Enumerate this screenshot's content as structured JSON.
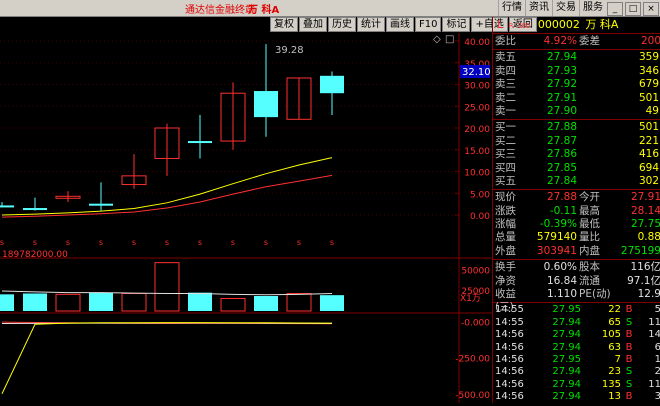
{
  "window": {
    "title": "通达信金融终端",
    "stock_title": "万 科A",
    "menu": [
      "行情",
      "资讯",
      "交易",
      "服务"
    ],
    "win_buttons": [
      "_",
      "□",
      "×"
    ]
  },
  "toolbar": [
    "复权",
    "叠加",
    "历史",
    "统计",
    "画线",
    "F10",
    "标记",
    "+自选",
    "返回"
  ],
  "chart_labels": {
    "high_mark": "39.28",
    "current_price_tag": "32.10",
    "volume_label": "189782000.00",
    "volume_unit": "X1万",
    "icons": [
      "◇",
      "□"
    ]
  },
  "chart_data": [
    {
      "type": "candlestick",
      "title": "",
      "ylim": [
        0,
        40
      ],
      "y_ticks": [
        0.0,
        5.0,
        10.0,
        15.0,
        20.0,
        25.0,
        30.0,
        35.0,
        40.0
      ],
      "candles": [
        {
          "open": 2.2,
          "close": 2.2,
          "high": 3.0,
          "low": 1.8,
          "color": "cyan"
        },
        {
          "open": 1.6,
          "close": 1.6,
          "high": 4.0,
          "low": 1.0,
          "color": "cyan"
        },
        {
          "open": 4.0,
          "close": 4.3,
          "high": 5.5,
          "low": 3.0,
          "color": "red"
        },
        {
          "open": 2.4,
          "close": 2.6,
          "high": 7.5,
          "low": 1.0,
          "color": "cyan"
        },
        {
          "open": 7.0,
          "close": 9.0,
          "high": 14.0,
          "low": 6.0,
          "color": "red"
        },
        {
          "open": 13.0,
          "close": 20.0,
          "high": 21.0,
          "low": 9.0,
          "color": "red"
        },
        {
          "open": 17.0,
          "close": 17.0,
          "high": 23.0,
          "low": 13.0,
          "color": "cyan"
        },
        {
          "open": 17.0,
          "close": 28.0,
          "high": 30.5,
          "low": 15.0,
          "color": "red"
        },
        {
          "open": 28.5,
          "close": 22.5,
          "high": 39.28,
          "low": 18.0,
          "color": "cyan"
        },
        {
          "open": 22.0,
          "close": 31.5,
          "high": 31.5,
          "low": 22.0,
          "color": "red"
        },
        {
          "open": 32.0,
          "close": 28.0,
          "high": 33.0,
          "low": 23.0,
          "color": "cyan"
        }
      ],
      "ma_series": [
        {
          "color": "#ffff00",
          "values": [
            0.0,
            0.2,
            0.5,
            0.9,
            1.5,
            2.8,
            4.8,
            7.2,
            9.5,
            11.5,
            13.2
          ]
        },
        {
          "color": "#ff3030",
          "values": [
            -0.5,
            -0.3,
            0.0,
            0.3,
            0.7,
            1.6,
            3.0,
            4.8,
            6.5,
            7.8,
            9.1
          ]
        }
      ]
    },
    {
      "type": "bar",
      "title": "",
      "ylim": [
        0,
        60000
      ],
      "y_ticks": [
        0,
        25000,
        50000
      ],
      "values": [
        20000,
        21000,
        20000,
        22000,
        21000,
        58000,
        22000,
        15000,
        18000,
        21000,
        19000
      ],
      "colors": [
        "cyan",
        "cyan",
        "red",
        "cyan",
        "red",
        "red",
        "cyan",
        "red",
        "cyan",
        "red",
        "cyan"
      ],
      "ma_values": [
        24000,
        23000,
        22000,
        22000,
        21500,
        21000,
        21000,
        20000,
        19500,
        20000,
        21000
      ]
    },
    {
      "type": "line",
      "title": "",
      "ylim": [
        -550,
        30
      ],
      "y_ticks": [
        -0.0,
        -250.0,
        -500.0
      ],
      "series": [
        {
          "color": "#ff3030",
          "values": [
            -5,
            -8,
            -10,
            -12,
            -14,
            -15,
            -14,
            -14,
            -15,
            -16,
            -17
          ]
        },
        {
          "color": "#e0e0e0",
          "values": [
            -15,
            -14,
            -13,
            -12,
            -12,
            -11,
            -11,
            -12,
            -13,
            -14,
            -15
          ]
        },
        {
          "color": "#ffff00",
          "values": [
            -500,
            -20,
            -12,
            -10,
            -10,
            -9,
            -9,
            -10,
            -10,
            -11,
            -12
          ]
        }
      ]
    }
  ],
  "quote": {
    "label": "L",
    "sub_r": "R",
    "sub_num": "300",
    "code": "000002",
    "name": "万 科A",
    "weibi_label": "委比",
    "weibi": "4.92%",
    "weicha_label": "委差",
    "weicha": "200",
    "sells": [
      {
        "label": "卖五",
        "price": "27.94",
        "vol": "359"
      },
      {
        "label": "卖四",
        "price": "27.93",
        "vol": "346"
      },
      {
        "label": "卖三",
        "price": "27.92",
        "vol": "679"
      },
      {
        "label": "卖二",
        "price": "27.91",
        "vol": "501"
      },
      {
        "label": "卖一",
        "price": "27.90",
        "vol": "49"
      }
    ],
    "buys": [
      {
        "label": "买一",
        "price": "27.88",
        "vol": "501"
      },
      {
        "label": "买二",
        "price": "27.87",
        "vol": "221"
      },
      {
        "label": "买三",
        "price": "27.86",
        "vol": "416"
      },
      {
        "label": "买四",
        "price": "27.85",
        "vol": "694"
      },
      {
        "label": "买五",
        "price": "27.84",
        "vol": "302"
      }
    ],
    "stats": [
      {
        "l1": "现价",
        "v1": "27.88",
        "c1": "red",
        "l2": "今开",
        "v2": "27.91",
        "c2": "red"
      },
      {
        "l1": "涨跌",
        "v1": "-0.11",
        "c1": "green",
        "l2": "最高",
        "v2": "28.14",
        "c2": "red"
      },
      {
        "l1": "涨幅",
        "v1": "-0.39%",
        "c1": "green",
        "l2": "最低",
        "v2": "27.75",
        "c2": "green"
      },
      {
        "l1": "总量",
        "v1": "579140",
        "c1": "yellow",
        "l2": "量比",
        "v2": "0.88",
        "c2": "yellow"
      },
      {
        "l1": "外盘",
        "v1": "303941",
        "c1": "red",
        "l2": "内盘",
        "v2": "275199",
        "c2": "green"
      }
    ],
    "fund": [
      {
        "l1": "换手",
        "v1": "0.60%",
        "l2": "股本",
        "v2": "116亿"
      },
      {
        "l1": "净资",
        "v1": "16.84",
        "l2": "流通",
        "v2": "97.1亿"
      },
      {
        "l1": "收益(三)",
        "v1": "1.110",
        "l2": "PE(动)",
        "v2": "12.9"
      }
    ],
    "ticks": [
      {
        "t": "14:55",
        "p": "27.95",
        "v": "22",
        "s": "B",
        "n": "5"
      },
      {
        "t": "14:55",
        "p": "27.94",
        "v": "65",
        "s": "S",
        "n": "11"
      },
      {
        "t": "14:56",
        "p": "27.94",
        "v": "105",
        "s": "B",
        "n": "14"
      },
      {
        "t": "14:56",
        "p": "27.94",
        "v": "63",
        "s": "B",
        "n": "6"
      },
      {
        "t": "14:56",
        "p": "27.95",
        "v": "7",
        "s": "B",
        "n": "1"
      },
      {
        "t": "14:56",
        "p": "27.94",
        "v": "23",
        "s": "S",
        "n": "2"
      },
      {
        "t": "14:56",
        "p": "27.94",
        "v": "135",
        "s": "S",
        "n": "11"
      },
      {
        "t": "14:56",
        "p": "27.94",
        "v": "13",
        "s": "B",
        "n": "3"
      }
    ]
  }
}
